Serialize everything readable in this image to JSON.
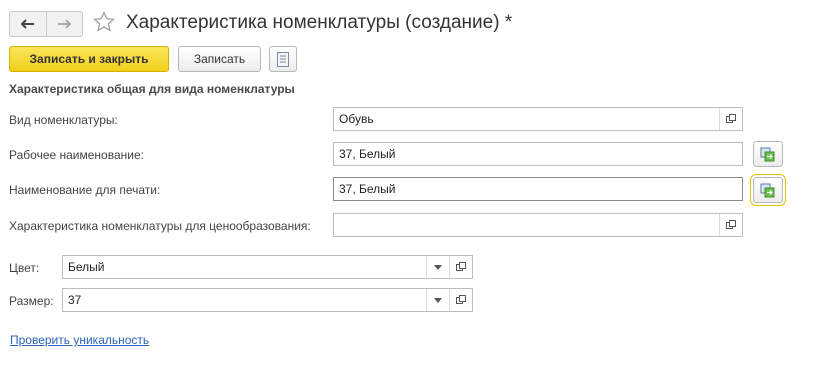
{
  "window": {
    "title": "Характеристика номенклатуры (создание) *"
  },
  "nav": {
    "back_icon": "arrow-left-icon",
    "forward_icon": "arrow-right-icon",
    "favorite_icon": "star-icon"
  },
  "toolbar": {
    "save_close_label": "Записать и закрыть",
    "save_label": "Записать",
    "more_icon": "document-list-icon"
  },
  "group": {
    "title": "Характеристика общая для вида номенклатуры"
  },
  "fields": {
    "kind": {
      "label": "Вид номенклатуры:",
      "value": "Обувь"
    },
    "work_name": {
      "label": "Рабочее наименование:",
      "value": "37, Белый"
    },
    "print_name": {
      "label": "Наименование для печати:",
      "value": "37, Белый"
    },
    "pricing": {
      "label": "Характеристика номенклатуры для ценообразования:",
      "value": ""
    },
    "color": {
      "label": "Цвет:",
      "value": "Белый"
    },
    "size": {
      "label": "Размер:",
      "value": "37"
    }
  },
  "links": {
    "check_unique": "Проверить уникальность"
  },
  "colors": {
    "accent_button": "#f5d626",
    "link": "#2a62b8",
    "focus": "#e8c000"
  }
}
